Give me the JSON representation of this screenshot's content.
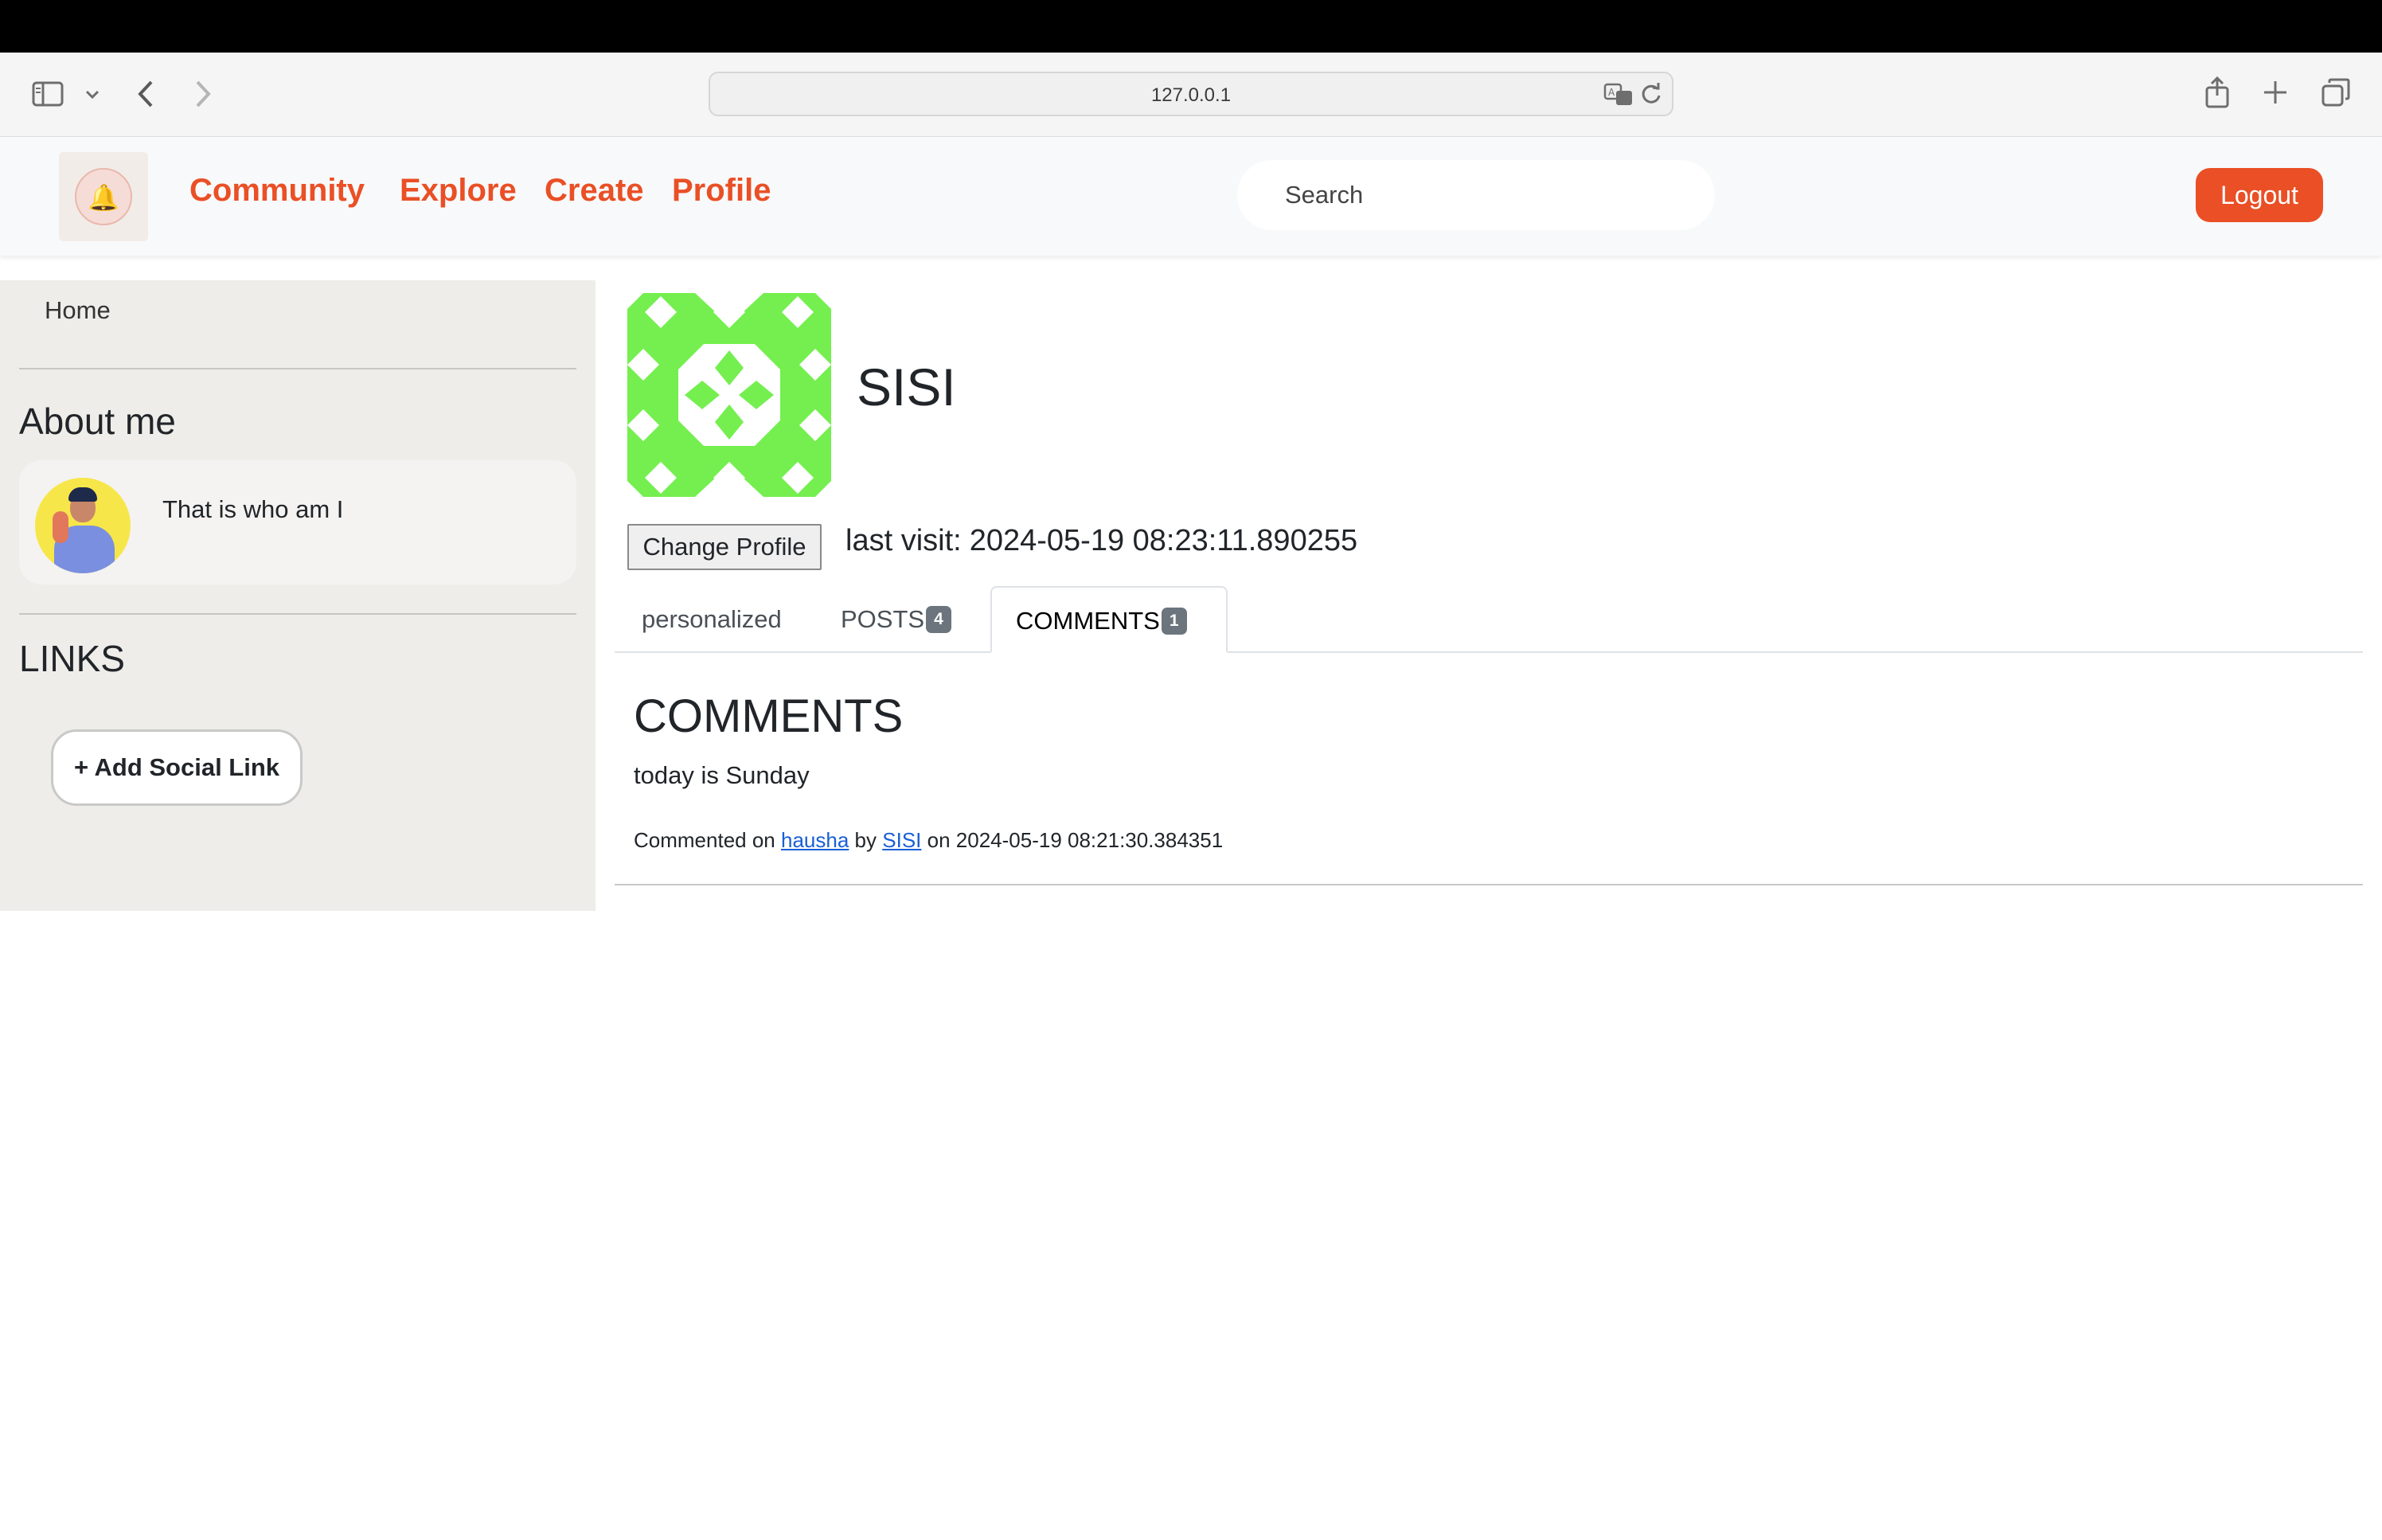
{
  "browser": {
    "url": "127.0.0.1",
    "icons": [
      "sidebar-toggle-icon",
      "chevron-down-icon",
      "back-arrow-icon",
      "forward-arrow-icon",
      "translate-icon",
      "reload-icon",
      "share-icon",
      "new-tab-icon",
      "tab-overview-icon"
    ]
  },
  "navbar": {
    "links": [
      "Community",
      "Explore",
      "Create",
      "Profile"
    ],
    "search_placeholder": "Search",
    "logout_label": "Logout",
    "accent_color": "#ea4f25",
    "logo_icon": "bell-icon"
  },
  "sidebar": {
    "home_label": "Home",
    "about_title": "About me",
    "about_text": "That is who am I",
    "links_title": "LINKS",
    "add_social_label": "+ Add Social Link"
  },
  "profile": {
    "username": "SISI",
    "change_profile_label": "Change Profile",
    "last_visit_label": "last visit:",
    "last_visit_value": "2024-05-19 08:23:11.890255",
    "identicon_color": "#74ef4f"
  },
  "tabs": {
    "personalized": "personalized",
    "posts": "POSTS",
    "posts_count": "4",
    "comments": "COMMENTS",
    "comments_count": "1",
    "active": "COMMENTS"
  },
  "comments": {
    "title": "COMMENTS",
    "items": [
      {
        "text": "today is Sunday",
        "prefix": "Commented on",
        "post": "hausha",
        "by_label": "by",
        "author": "SISI",
        "on_label": "on",
        "timestamp": "2024-05-19 08:21:30.384351"
      }
    ]
  }
}
